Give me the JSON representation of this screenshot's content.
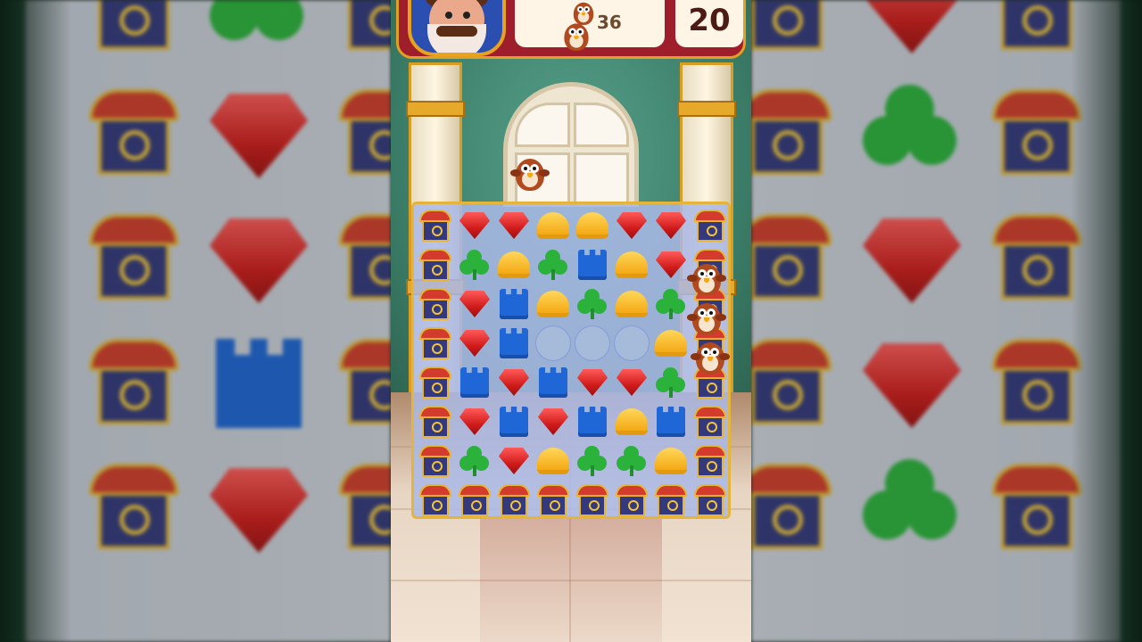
{
  "hud": {
    "goal_count": "36",
    "moves_left": "20"
  },
  "board": {
    "rows": 8,
    "cols": 8,
    "grid": [
      [
        "house",
        "gem",
        "gem",
        "helmet",
        "helmet",
        "gem",
        "gem",
        "house"
      ],
      [
        "house",
        "clover",
        "helmet",
        "clover",
        "tower",
        "helmet",
        "gem",
        "house"
      ],
      [
        "house",
        "gem",
        "tower",
        "helmet",
        "clover",
        "helmet",
        "clover",
        "house"
      ],
      [
        "house",
        "gem",
        "tower",
        "",
        "",
        "",
        "helmet",
        "house"
      ],
      [
        "house",
        "tower",
        "gem",
        "tower",
        "gem",
        "gem",
        "clover",
        "house"
      ],
      [
        "house",
        "gem",
        "tower",
        "gem",
        "tower",
        "helmet",
        "tower",
        "house"
      ],
      [
        "house",
        "clover",
        "gem",
        "helmet",
        "clover",
        "clover",
        "helmet",
        "house"
      ],
      [
        "house",
        "house",
        "house",
        "house",
        "house",
        "house",
        "house",
        "house"
      ]
    ]
  },
  "colors": {
    "gem": "#d11b1b",
    "clover": "#2bb23b",
    "helmet": "#f4a915",
    "tower": "#1f66d6",
    "house_body": "#34387c",
    "house_roof": "#d33b2c",
    "hud_red": "#9e1e2c",
    "gold_border": "#e5b43a"
  },
  "icons": {
    "avatar": "king-avatar-icon",
    "goal": "owl-goal-icon"
  }
}
